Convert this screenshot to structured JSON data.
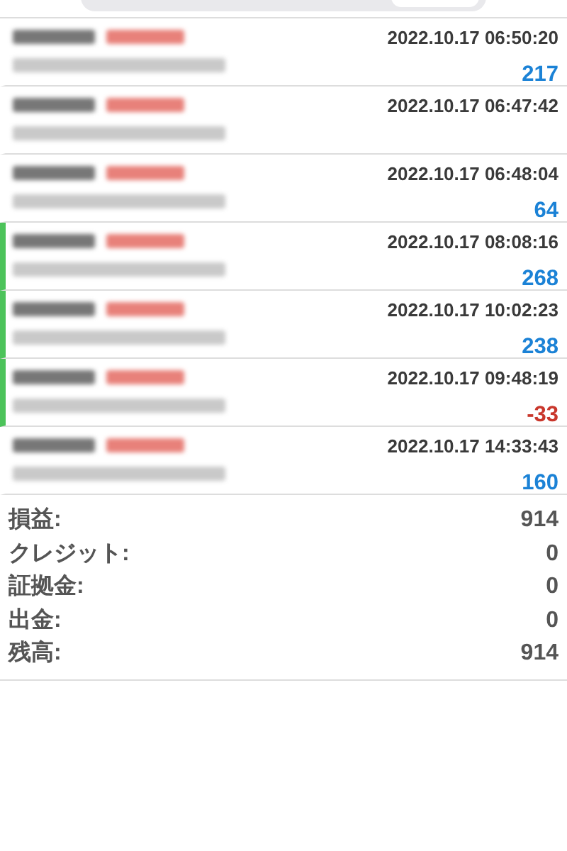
{
  "deals": [
    {
      "time": "2022.10.17 06:50:20",
      "profit": "217",
      "negative": false,
      "flagged": false,
      "blurred_detail": true
    },
    {
      "time": "2022.10.17 06:47:42",
      "flagged": false,
      "blurred_detail": true
    },
    {
      "time": "2022.10.17 06:48:04",
      "profit": "64",
      "negative": false,
      "flagged": false,
      "blurred_detail": true
    },
    {
      "time": "2022.10.17 08:08:16",
      "profit": "268",
      "negative": false,
      "flagged": true,
      "blurred_detail": true
    },
    {
      "time": "2022.10.17 10:02:23",
      "profit": "238",
      "negative": false,
      "flagged": true,
      "blurred_detail": true
    },
    {
      "time": "2022.10.17 09:48:19",
      "profit": "-33",
      "negative": true,
      "flagged": true,
      "blurred_detail": true
    },
    {
      "time": "2022.10.17 14:33:43",
      "profit": "160",
      "negative": false,
      "flagged": false,
      "blurred_detail": true
    }
  ],
  "summary": [
    {
      "label": "損益:",
      "value": "914"
    },
    {
      "label": "クレジット:",
      "value": "0"
    },
    {
      "label": "証拠金:",
      "value": "0"
    },
    {
      "label": "出金:",
      "value": "0"
    },
    {
      "label": "残高:",
      "value": "914"
    }
  ]
}
